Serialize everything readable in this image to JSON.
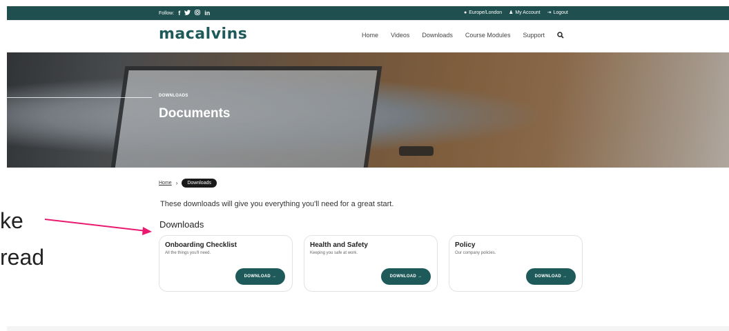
{
  "topbar": {
    "follow_label": "Follow:",
    "social_icons": [
      "facebook-icon",
      "twitter-icon",
      "instagram-icon",
      "linkedin-icon"
    ],
    "timezone": "Europe/London",
    "account": "My Account",
    "logout": "Logout"
  },
  "header": {
    "logo": "macalvins",
    "nav": [
      "Home",
      "Videos",
      "Downloads",
      "Course Modules",
      "Support"
    ]
  },
  "hero": {
    "kicker": "DOWNLOADS",
    "title": "Documents"
  },
  "breadcrumb": {
    "home": "Home",
    "current": "Downloads"
  },
  "main": {
    "intro": "These downloads will give you everything you'll need for a great start.",
    "heading": "Downloads",
    "cards": [
      {
        "title": "Onboarding Checklist",
        "subtitle": "All the things you'll need.",
        "button": "DOWNLOAD →"
      },
      {
        "title": "Health and Safety",
        "subtitle": "Keeping you safe at work.",
        "button": "DOWNLOAD →"
      },
      {
        "title": "Policy",
        "subtitle": "Our company policies.",
        "button": "DOWNLOAD →"
      }
    ]
  },
  "overlay": {
    "line1": "ke",
    "line2": "read",
    "arrow_color": "#e8196e"
  },
  "colors": {
    "brand": "#1f5a5a",
    "topbar": "#1f4f4f"
  }
}
